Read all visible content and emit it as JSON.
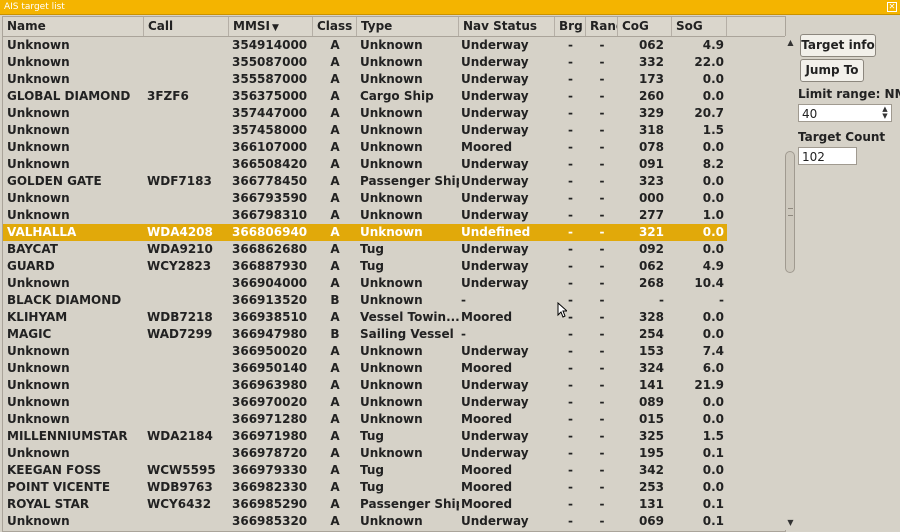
{
  "window": {
    "title": "AIS target list"
  },
  "columns": [
    {
      "label": "Name"
    },
    {
      "label": "Call"
    },
    {
      "label": "MMSI",
      "sort_indicator": "▼"
    },
    {
      "label": "Class"
    },
    {
      "label": "Type"
    },
    {
      "label": "Nav Status"
    },
    {
      "label": "Brg"
    },
    {
      "label": "Rang"
    },
    {
      "label": "CoG"
    },
    {
      "label": "SoG"
    }
  ],
  "rows": [
    [
      "Unknown",
      "",
      "354914000",
      "A",
      "Unknown",
      "Underway",
      "-",
      "-",
      "062",
      "4.9"
    ],
    [
      "Unknown",
      "",
      "355087000",
      "A",
      "Unknown",
      "Underway",
      "-",
      "-",
      "332",
      "22.0"
    ],
    [
      "Unknown",
      "",
      "355587000",
      "A",
      "Unknown",
      "Underway",
      "-",
      "-",
      "173",
      "0.0"
    ],
    [
      "GLOBAL DIAMOND",
      "3FZF6",
      "356375000",
      "A",
      "Cargo Ship",
      "Underway",
      "-",
      "-",
      "260",
      "0.0"
    ],
    [
      "Unknown",
      "",
      "357447000",
      "A",
      "Unknown",
      "Underway",
      "-",
      "-",
      "329",
      "20.7"
    ],
    [
      "Unknown",
      "",
      "357458000",
      "A",
      "Unknown",
      "Underway",
      "-",
      "-",
      "318",
      "1.5"
    ],
    [
      "Unknown",
      "",
      "366107000",
      "A",
      "Unknown",
      "Moored",
      "-",
      "-",
      "078",
      "0.0"
    ],
    [
      "Unknown",
      "",
      "366508420",
      "A",
      "Unknown",
      "Underway",
      "-",
      "-",
      "091",
      "8.2"
    ],
    [
      "GOLDEN GATE",
      "WDF7183",
      "366778450",
      "A",
      "Passenger Ship",
      "Underway",
      "-",
      "-",
      "323",
      "0.0"
    ],
    [
      "Unknown",
      "",
      "366793590",
      "A",
      "Unknown",
      "Underway",
      "-",
      "-",
      "000",
      "0.0"
    ],
    [
      "Unknown",
      "",
      "366798310",
      "A",
      "Unknown",
      "Underway",
      "-",
      "-",
      "277",
      "1.0"
    ],
    [
      "VALHALLA",
      "WDA4208",
      "366806940",
      "A",
      "Unknown",
      "Undefined",
      "-",
      "-",
      "321",
      "0.0"
    ],
    [
      "BAYCAT",
      "WDA9210",
      "366862680",
      "A",
      "Tug",
      "Underway",
      "-",
      "-",
      "092",
      "0.0"
    ],
    [
      "GUARD",
      "WCY2823",
      "366887930",
      "A",
      "Tug",
      "Underway",
      "-",
      "-",
      "062",
      "4.9"
    ],
    [
      "Unknown",
      "",
      "366904000",
      "A",
      "Unknown",
      "Underway",
      "-",
      "-",
      "268",
      "10.4"
    ],
    [
      "BLACK DIAMOND",
      "",
      "366913520",
      "B",
      "Unknown",
      "-",
      "-",
      "-",
      "-",
      "-"
    ],
    [
      "KLIHYAM",
      "WDB7218",
      "366938510",
      "A",
      "Vessel Towin...",
      "Moored",
      "-",
      "-",
      "328",
      "0.0"
    ],
    [
      "MAGIC",
      "WAD7299",
      "366947980",
      "B",
      "Sailing Vessel",
      "-",
      "-",
      "-",
      "254",
      "0.0"
    ],
    [
      "Unknown",
      "",
      "366950020",
      "A",
      "Unknown",
      "Underway",
      "-",
      "-",
      "153",
      "7.4"
    ],
    [
      "Unknown",
      "",
      "366950140",
      "A",
      "Unknown",
      "Moored",
      "-",
      "-",
      "324",
      "6.0"
    ],
    [
      "Unknown",
      "",
      "366963980",
      "A",
      "Unknown",
      "Underway",
      "-",
      "-",
      "141",
      "21.9"
    ],
    [
      "Unknown",
      "",
      "366970020",
      "A",
      "Unknown",
      "Underway",
      "-",
      "-",
      "089",
      "0.0"
    ],
    [
      "Unknown",
      "",
      "366971280",
      "A",
      "Unknown",
      "Moored",
      "-",
      "-",
      "015",
      "0.0"
    ],
    [
      "MILLENNIUMSTAR",
      "WDA2184",
      "366971980",
      "A",
      "Tug",
      "Underway",
      "-",
      "-",
      "325",
      "1.5"
    ],
    [
      "Unknown",
      "",
      "366978720",
      "A",
      "Unknown",
      "Underway",
      "-",
      "-",
      "195",
      "0.1"
    ],
    [
      "KEEGAN FOSS",
      "WCW5595",
      "366979330",
      "A",
      "Tug",
      "Moored",
      "-",
      "-",
      "342",
      "0.0"
    ],
    [
      "POINT VICENTE",
      "WDB9763",
      "366982330",
      "A",
      "Tug",
      "Moored",
      "-",
      "-",
      "253",
      "0.0"
    ],
    [
      "ROYAL STAR",
      "WCY6432",
      "366985290",
      "A",
      "Passenger Ship",
      "Moored",
      "-",
      "-",
      "131",
      "0.1"
    ],
    [
      "Unknown",
      "",
      "366985320",
      "A",
      "Unknown",
      "Underway",
      "-",
      "-",
      "069",
      "0.1"
    ]
  ],
  "selected_row_index": 11,
  "side_panel": {
    "target_info_label": "Target info",
    "jump_to_label": "Jump To",
    "limit_range_label": "Limit range: NM",
    "limit_range_value": "40",
    "target_count_label": "Target Count",
    "target_count_value": "102"
  },
  "colors": {
    "titlebar": "#f4b400",
    "selected_row": "#e1a90a"
  }
}
